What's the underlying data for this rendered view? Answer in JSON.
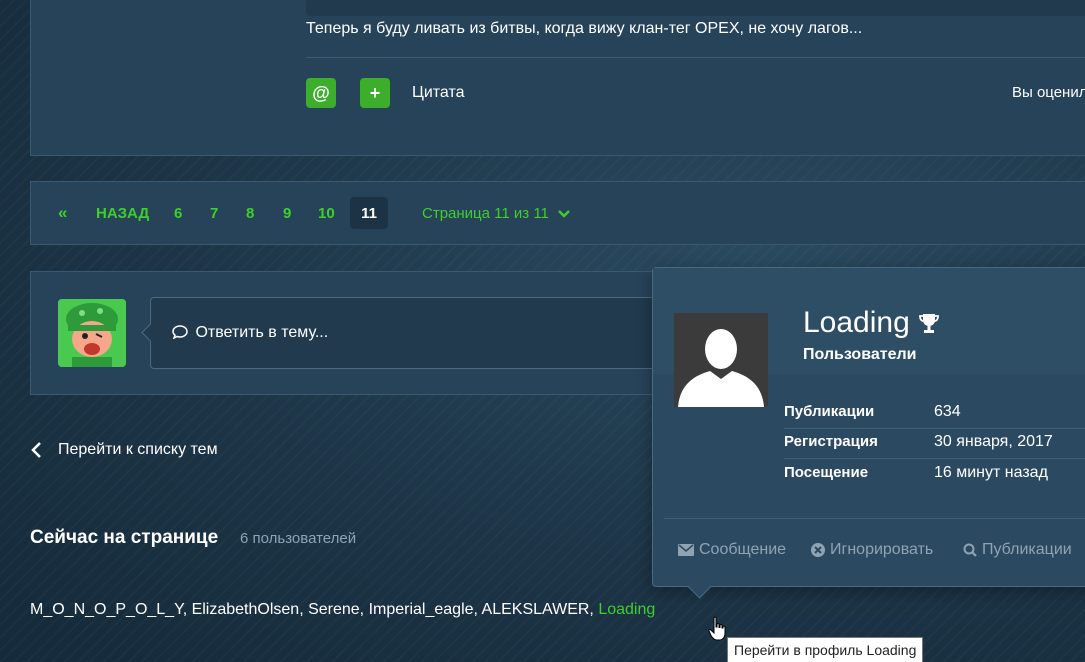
{
  "post": {
    "text": "Теперь я буду ливать из битвы, когда вижу клан-тег OPEX, не хочу лагов...",
    "mention_label": "@",
    "plus_label": "+",
    "quote_label": "Цитата",
    "rated_label": "Вы оценил"
  },
  "pagination": {
    "first_icon": "«",
    "prev_label": "НАЗАД",
    "pages": [
      "6",
      "7",
      "8",
      "9",
      "10"
    ],
    "current": "11",
    "page_of": "Страница 11 из 11"
  },
  "reply": {
    "placeholder": "Ответить в тему..."
  },
  "back_link": "Перейти к списку тем",
  "online": {
    "title": "Сейчас на странице",
    "count": "6 пользователей",
    "users_text": "M_O_N_O_P_O_L_Y, ElizabethOlsen, Serene, Imperial_eagle, ALEKSLAWER, ",
    "highlight_user": "Loading"
  },
  "hovercard": {
    "name": "Loading",
    "group": "Пользователи",
    "stats": [
      {
        "label": "Публикации",
        "value": "634"
      },
      {
        "label": "Регистрация",
        "value": "30 января, 2017"
      },
      {
        "label": "Посещение",
        "value": "16 минут назад"
      }
    ],
    "actions": {
      "message": "Сообщение",
      "ignore": "Игнорировать",
      "posts": "Публикации"
    }
  },
  "tooltip": "Перейти в профиль Loading",
  "colors": {
    "accent_green": "#3ecf2b",
    "button_green": "#3cae2c",
    "panel": "#27435a",
    "muted": "#8fa3b3"
  }
}
